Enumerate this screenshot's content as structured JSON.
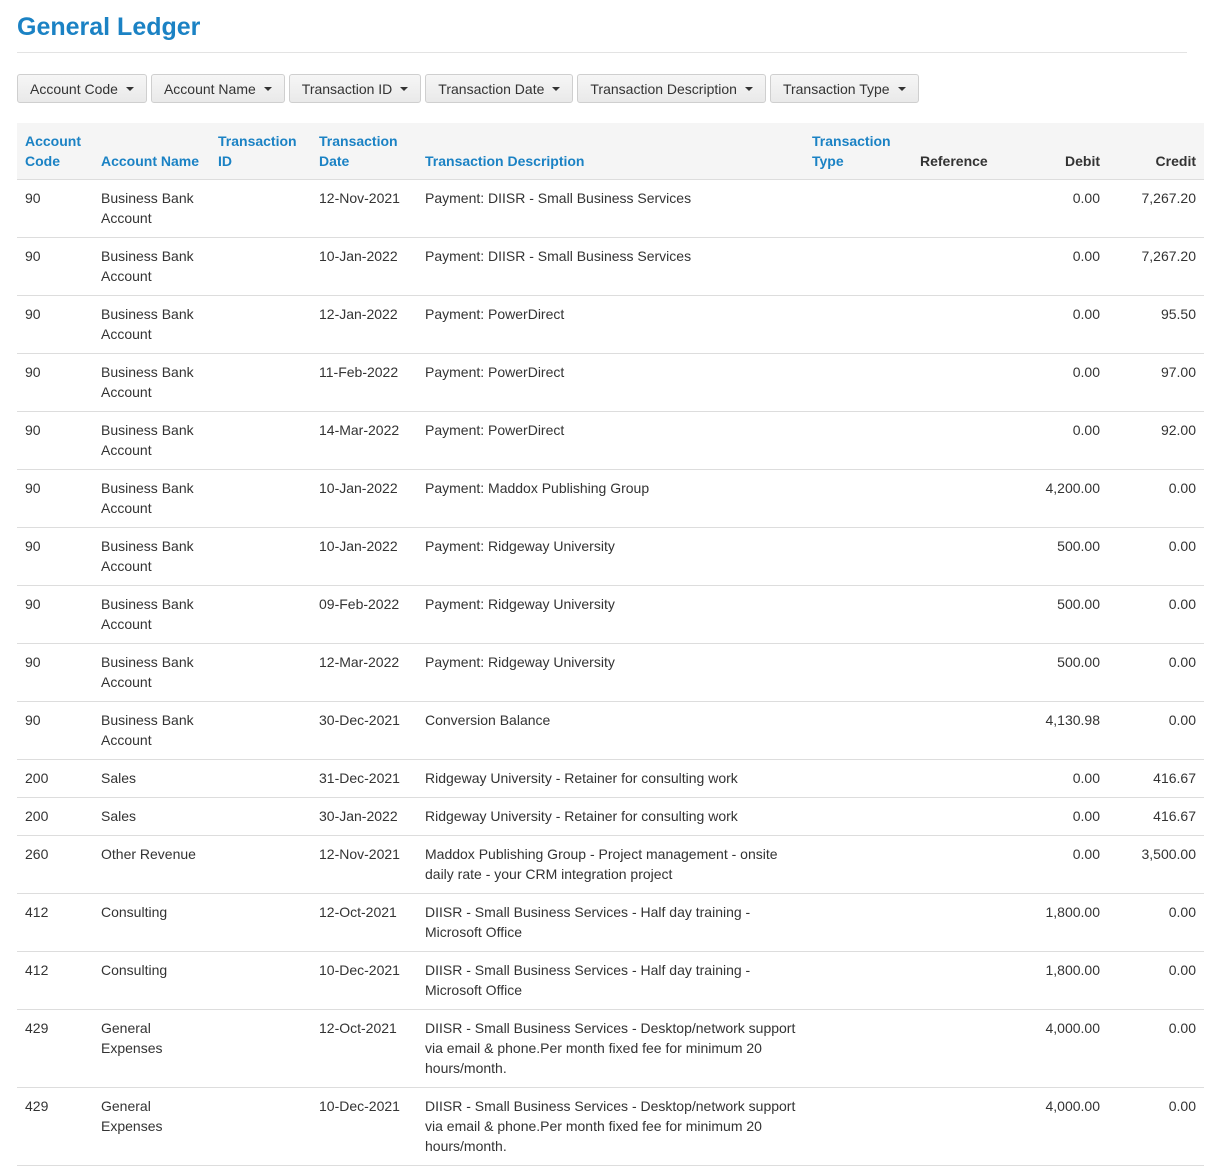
{
  "page": {
    "title": "General Ledger"
  },
  "filters": [
    {
      "label": "Account Code"
    },
    {
      "label": "Account Name"
    },
    {
      "label": "Transaction ID"
    },
    {
      "label": "Transaction Date"
    },
    {
      "label": "Transaction Description"
    },
    {
      "label": "Transaction Type"
    }
  ],
  "table": {
    "headers": {
      "account_code": "Account Code",
      "account_name": "Account Name",
      "transaction_id": "Transaction ID",
      "transaction_date": "Transaction Date",
      "transaction_description": "Transaction Description",
      "transaction_type": "Transaction Type",
      "reference": "Reference",
      "debit": "Debit",
      "credit": "Credit"
    },
    "rows": [
      {
        "code": "90",
        "name": "Business Bank Account",
        "id": "",
        "date": "12-Nov-2021",
        "description": "Payment: DIISR - Small Business Services",
        "type": "",
        "reference": "",
        "debit": "0.00",
        "credit": "7,267.20"
      },
      {
        "code": "90",
        "name": "Business Bank Account",
        "id": "",
        "date": "10-Jan-2022",
        "description": "Payment: DIISR - Small Business Services",
        "type": "",
        "reference": "",
        "debit": "0.00",
        "credit": "7,267.20"
      },
      {
        "code": "90",
        "name": "Business Bank Account",
        "id": "",
        "date": "12-Jan-2022",
        "description": "Payment: PowerDirect",
        "type": "",
        "reference": "",
        "debit": "0.00",
        "credit": "95.50"
      },
      {
        "code": "90",
        "name": "Business Bank Account",
        "id": "",
        "date": "11-Feb-2022",
        "description": "Payment: PowerDirect",
        "type": "",
        "reference": "",
        "debit": "0.00",
        "credit": "97.00"
      },
      {
        "code": "90",
        "name": "Business Bank Account",
        "id": "",
        "date": "14-Mar-2022",
        "description": "Payment: PowerDirect",
        "type": "",
        "reference": "",
        "debit": "0.00",
        "credit": "92.00"
      },
      {
        "code": "90",
        "name": "Business Bank Account",
        "id": "",
        "date": "10-Jan-2022",
        "description": "Payment: Maddox Publishing Group",
        "type": "",
        "reference": "",
        "debit": "4,200.00",
        "credit": "0.00"
      },
      {
        "code": "90",
        "name": "Business Bank Account",
        "id": "",
        "date": "10-Jan-2022",
        "description": "Payment: Ridgeway University",
        "type": "",
        "reference": "",
        "debit": "500.00",
        "credit": "0.00"
      },
      {
        "code": "90",
        "name": "Business Bank Account",
        "id": "",
        "date": "09-Feb-2022",
        "description": "Payment: Ridgeway University",
        "type": "",
        "reference": "",
        "debit": "500.00",
        "credit": "0.00"
      },
      {
        "code": "90",
        "name": "Business Bank Account",
        "id": "",
        "date": "12-Mar-2022",
        "description": "Payment: Ridgeway University",
        "type": "",
        "reference": "",
        "debit": "500.00",
        "credit": "0.00"
      },
      {
        "code": "90",
        "name": "Business Bank Account",
        "id": "",
        "date": "30-Dec-2021",
        "description": "Conversion Balance",
        "type": "",
        "reference": "",
        "debit": "4,130.98",
        "credit": "0.00"
      },
      {
        "code": "200",
        "name": "Sales",
        "id": "",
        "date": "31-Dec-2021",
        "description": "Ridgeway University - Retainer for consulting work",
        "type": "",
        "reference": "",
        "debit": "0.00",
        "credit": "416.67"
      },
      {
        "code": "200",
        "name": "Sales",
        "id": "",
        "date": "30-Jan-2022",
        "description": "Ridgeway University - Retainer for consulting work",
        "type": "",
        "reference": "",
        "debit": "0.00",
        "credit": "416.67"
      },
      {
        "code": "260",
        "name": "Other Revenue",
        "id": "",
        "date": "12-Nov-2021",
        "description": "Maddox Publishing Group - Project management - onsite daily rate - your CRM integration project",
        "type": "",
        "reference": "",
        "debit": "0.00",
        "credit": "3,500.00"
      },
      {
        "code": "412",
        "name": "Consulting",
        "id": "",
        "date": "12-Oct-2021",
        "description": "DIISR - Small Business Services - Half day training - Microsoft Office",
        "type": "",
        "reference": "",
        "debit": "1,800.00",
        "credit": "0.00"
      },
      {
        "code": "412",
        "name": "Consulting",
        "id": "",
        "date": "10-Dec-2021",
        "description": "DIISR - Small Business Services - Half day training - Microsoft Office",
        "type": "",
        "reference": "",
        "debit": "1,800.00",
        "credit": "0.00"
      },
      {
        "code": "429",
        "name": "General Expenses",
        "id": "",
        "date": "12-Oct-2021",
        "description": "DIISR - Small Business Services - Desktop/network support via email & phone.Per month fixed fee for minimum 20 hours/month.",
        "type": "",
        "reference": "",
        "debit": "4,000.00",
        "credit": "0.00"
      },
      {
        "code": "429",
        "name": "General Expenses",
        "id": "",
        "date": "10-Dec-2021",
        "description": "DIISR - Small Business Services - Desktop/network support via email & phone.Per month fixed fee for minimum 20 hours/month.",
        "type": "",
        "reference": "",
        "debit": "4,000.00",
        "credit": "0.00"
      }
    ]
  },
  "icons": {
    "filter_caret": "caret-down-icon"
  },
  "colors": {
    "accent": "#1b82c4",
    "header_bg": "#f5f5f5",
    "border": "#dddddd"
  }
}
